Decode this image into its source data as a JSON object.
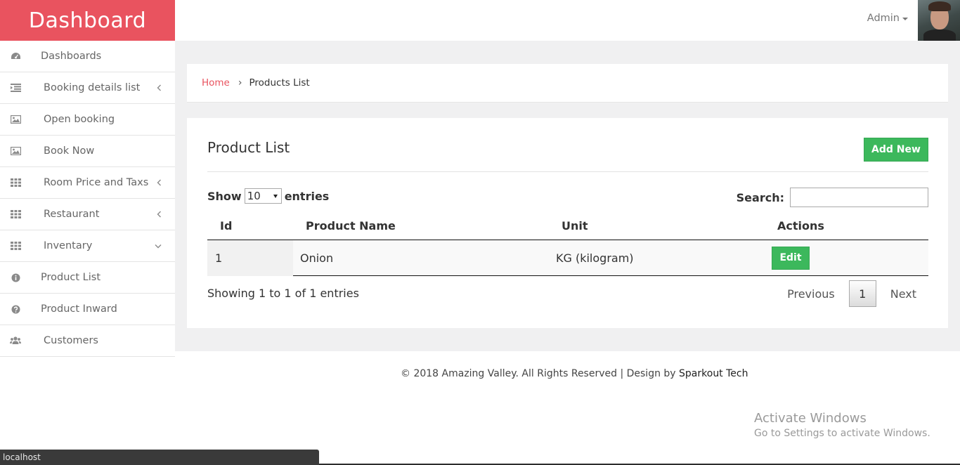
{
  "brand": {
    "title": "Dashboard",
    "color": "#e9535f"
  },
  "sidebar": {
    "items": [
      {
        "label": "Dashboards",
        "icon": "tachometer-icon"
      },
      {
        "label": "Booking details list",
        "icon": "list-indent-icon",
        "chevron": "left"
      },
      {
        "label": "Open booking",
        "icon": "image-icon"
      },
      {
        "label": "Book Now",
        "icon": "image-icon"
      },
      {
        "label": "Room Price and Taxs",
        "icon": "grid-icon",
        "chevron": "left"
      },
      {
        "label": "Restaurant",
        "icon": "grid-icon",
        "chevron": "left"
      },
      {
        "label": "Inventary",
        "icon": "grid-icon",
        "chevron": "down"
      },
      {
        "label": "Product List",
        "icon": "info-circle-icon"
      },
      {
        "label": "Product Inward",
        "icon": "question-circle-icon"
      },
      {
        "label": "Customers",
        "icon": "users-icon"
      }
    ]
  },
  "header": {
    "user_label": "Admin"
  },
  "breadcrumb": {
    "home": "Home",
    "current": "Products List"
  },
  "card": {
    "title": "Product List",
    "add_button": "Add New",
    "show_label": "Show",
    "entries_value": "10",
    "entries_label": "entries",
    "search_label": "Search:",
    "search_value": "",
    "columns": [
      "Id",
      "Product Name",
      "Unit",
      "Actions"
    ],
    "rows": [
      {
        "id": "1",
        "name": "Onion",
        "unit": "KG (kilogram)",
        "action": "Edit"
      }
    ],
    "info": "Showing 1 to 1 of 1 entries",
    "pager": {
      "previous": "Previous",
      "page": "1",
      "next": "Next"
    }
  },
  "footer": {
    "text": "© 2018 Amazing Valley. All Rights Reserved | Design by ",
    "link": "Sparkout Tech"
  },
  "windows_watermark": {
    "title": "Activate Windows",
    "subtitle": "Go to Settings to activate Windows."
  },
  "status_bar": {
    "url": "localhost"
  },
  "colors": {
    "accent": "#e9535f",
    "success": "#3cb85c",
    "background": "#f0f0f1"
  }
}
